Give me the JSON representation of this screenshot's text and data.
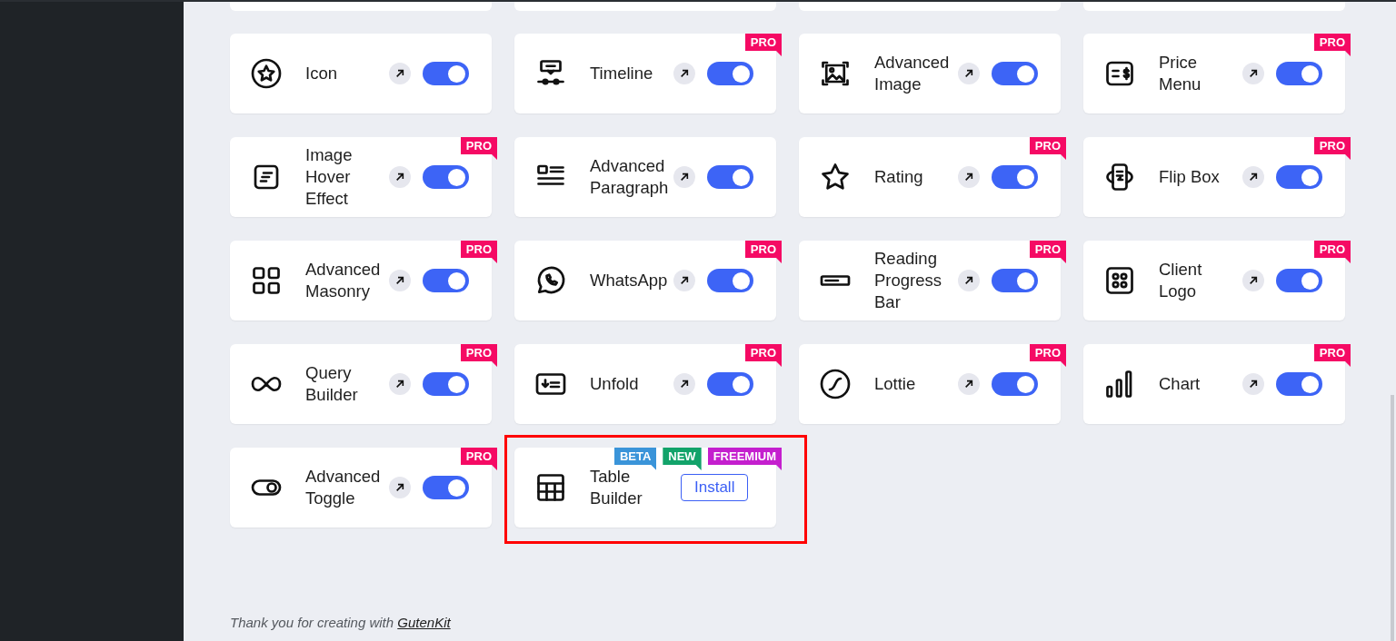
{
  "blocks": [
    {
      "label": "Icon",
      "on": true
    },
    {
      "label": "Timeline",
      "on": true,
      "badges": [
        {
          "label": "PRO",
          "color": "#f50a64"
        }
      ]
    },
    {
      "label": "Advanced Image",
      "on": true
    },
    {
      "label": "Price Menu",
      "on": true,
      "badges": [
        {
          "label": "PRO",
          "color": "#f50a64"
        }
      ]
    },
    {
      "label": "Image Hover Effect",
      "on": true,
      "badges": [
        {
          "label": "PRO",
          "color": "#f50a64"
        }
      ]
    },
    {
      "label": "Advanced Paragraph",
      "on": true
    },
    {
      "label": "Rating",
      "on": true,
      "badges": [
        {
          "label": "PRO",
          "color": "#f50a64"
        }
      ]
    },
    {
      "label": "Flip Box",
      "on": true,
      "badges": [
        {
          "label": "PRO",
          "color": "#f50a64"
        }
      ]
    },
    {
      "label": "Advanced Masonry",
      "on": true,
      "badges": [
        {
          "label": "PRO",
          "color": "#f50a64"
        }
      ]
    },
    {
      "label": "WhatsApp",
      "on": true,
      "badges": [
        {
          "label": "PRO",
          "color": "#f50a64"
        }
      ]
    },
    {
      "label": "Reading Progress Bar",
      "on": true,
      "badges": [
        {
          "label": "PRO",
          "color": "#f50a64"
        }
      ]
    },
    {
      "label": "Client Logo",
      "on": true,
      "badges": [
        {
          "label": "PRO",
          "color": "#f50a64"
        }
      ]
    },
    {
      "label": "Query Builder",
      "on": true,
      "badges": [
        {
          "label": "PRO",
          "color": "#f50a64"
        }
      ]
    },
    {
      "label": "Unfold",
      "on": true,
      "badges": [
        {
          "label": "PRO",
          "color": "#f50a64"
        }
      ]
    },
    {
      "label": "Lottie",
      "on": true,
      "badges": [
        {
          "label": "PRO",
          "color": "#f50a64"
        }
      ]
    },
    {
      "label": "Chart",
      "on": true,
      "badges": [
        {
          "label": "PRO",
          "color": "#f50a64"
        }
      ]
    },
    {
      "label": "Advanced Toggle",
      "on": true,
      "badges": [
        {
          "label": "PRO",
          "color": "#f50a64"
        }
      ]
    },
    {
      "label": "Table Builder",
      "kind": "install",
      "button": "Install",
      "highlighted": true,
      "badges": [
        {
          "label": "BETA",
          "color": "#3a94d9"
        },
        {
          "label": "NEW",
          "color": "#12a36a"
        },
        {
          "label": "FREEMIUM",
          "color": "#c41fce"
        }
      ]
    }
  ],
  "footer": {
    "text": "Thank you for creating with",
    "link": "GutenKit"
  }
}
